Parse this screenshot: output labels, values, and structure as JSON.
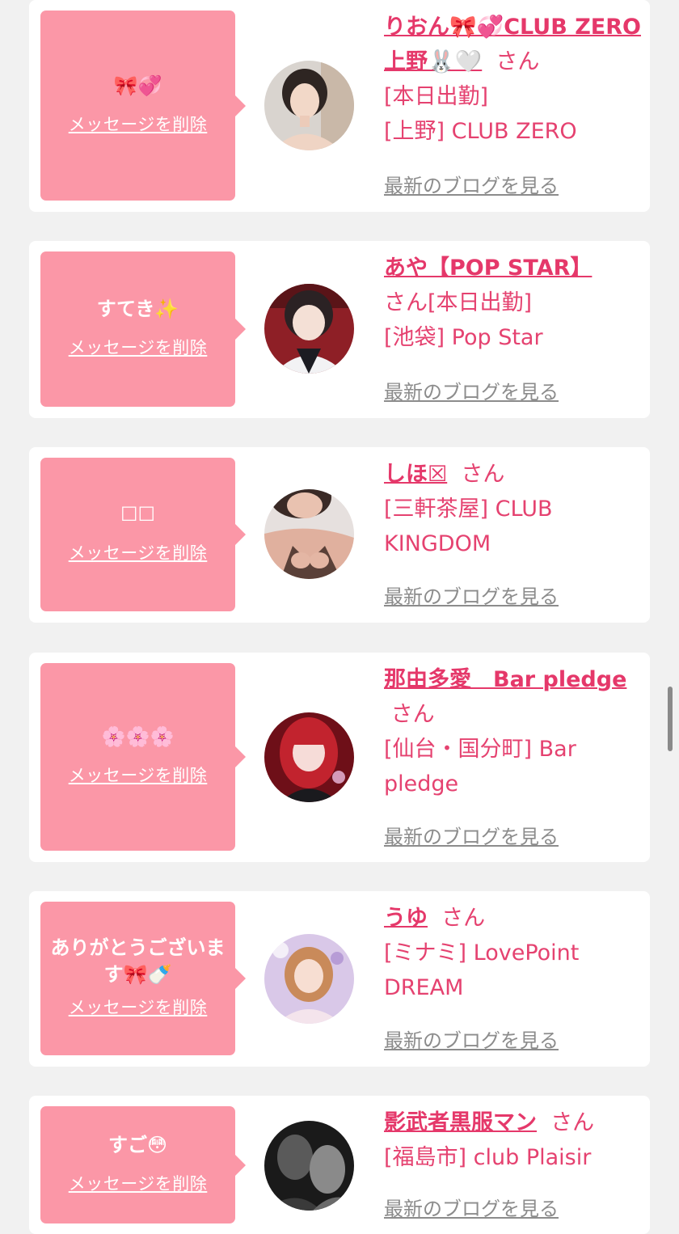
{
  "delete_label": "メッセージを削除",
  "blog_label": "最新のブログを見る",
  "san_label": "さん",
  "cards": [
    {
      "message": "🎀💞",
      "name": "りおん🎀💞CLUB ZERO 上野🐰🤍",
      "status": "[本日出勤]",
      "shop": "[上野] CLUB ZERO",
      "avatar_icon": "woman-avatar-photo"
    },
    {
      "message": "すてき✨",
      "name": "あや【POP STAR】",
      "status": "[本日出勤]",
      "shop": "[池袋] Pop Star",
      "avatar_icon": "woman-avatar-photo"
    },
    {
      "message": "☐☐",
      "name": "しほ☒",
      "status": "",
      "shop": "[三軒茶屋] CLUB KINGDOM",
      "avatar_icon": "woman-avatar-photo"
    },
    {
      "message": "🌸🌸🌸",
      "name": "那由多愛　Bar pledge",
      "status": "",
      "shop": "[仙台・国分町] Bar pledge",
      "avatar_icon": "woman-avatar-photo"
    },
    {
      "message": "ありがとうございます🎀🍼",
      "name": "うゆ",
      "status": "",
      "shop": "[ミナミ] LovePoint DREAM",
      "avatar_icon": "woman-avatar-photo"
    },
    {
      "message": "すご😳",
      "name": "影武者黒服マン",
      "status": "",
      "shop": "[福島市] club Plaisir",
      "avatar_icon": "man-avatar-photo"
    }
  ],
  "colors": {
    "bubble": "#fb97a7",
    "name": "#e5386a",
    "text": "#e54270",
    "blog_link": "#8c8c8c",
    "background": "#f1f1f1"
  }
}
